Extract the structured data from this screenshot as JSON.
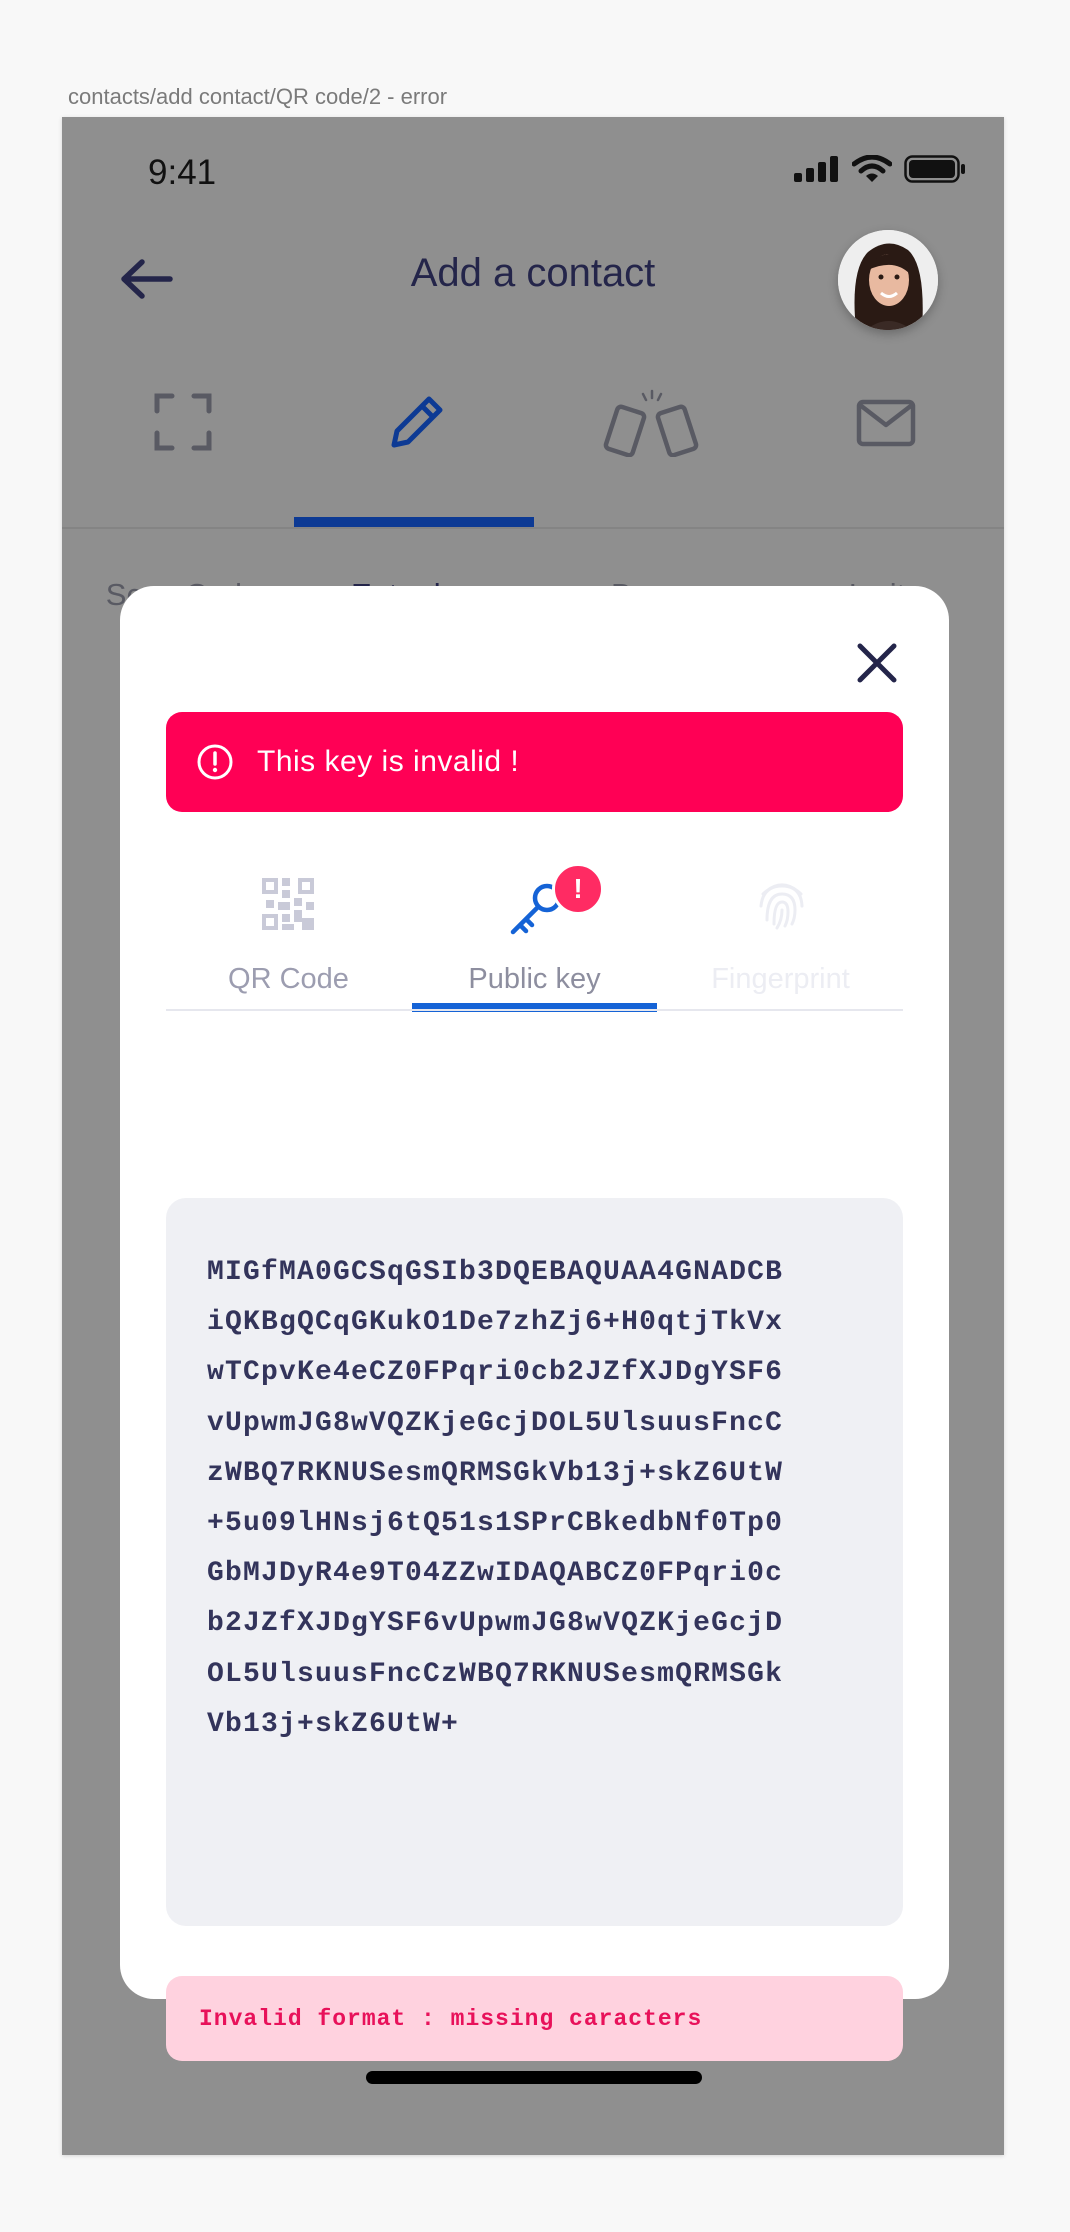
{
  "artboard": {
    "label": "contacts/add contact/QR code/2 - error"
  },
  "status_bar": {
    "time": "9:41",
    "icons": [
      "signal-icon",
      "wifi-icon",
      "battery-icon"
    ]
  },
  "header": {
    "title": "Add a contact",
    "back_icon": "arrow-left-icon"
  },
  "mode_tabs": [
    {
      "label": "Scan Code",
      "icon": "scan-frame-icon",
      "active": false
    },
    {
      "label": "Enter key",
      "icon": "pencil-icon",
      "active": true
    },
    {
      "label": "Bump",
      "icon": "bump-phones-icon",
      "active": false
    },
    {
      "label": "Invite",
      "icon": "envelope-icon",
      "active": false
    }
  ],
  "modal": {
    "error_banner": "This key is invalid !",
    "tabs": [
      {
        "label": "QR Code",
        "icon": "qr-code-icon",
        "state": "inactive"
      },
      {
        "label": "Public key",
        "icon": "key-icon",
        "state": "active",
        "badge": "!"
      },
      {
        "label": "Fingerprint",
        "icon": "fingerprint-icon",
        "state": "disabled"
      }
    ],
    "key_lines": [
      "MIGfMA0GCSqGSIb3DQEBAQUAA4GNADCB",
      "iQKBgQCqGKukO1De7zhZj6+H0qtjTkVx",
      "wTCpvKe4eCZ0FPqri0cb2JZfXJDgYSF6",
      "vUpwmJG8wVQZKjeGcjDOL5UlsuusFncC",
      "zWBQ7RKNUSesmQRMSGkVb1​3j+skZ6UtW",
      "+5u09lHNsj6tQ51s1SPrCBkedbNf0Tp0",
      "GbMJDyR4e9T04ZZwIDAQABCZ0FPqri0c",
      "b2JZfXJDgYSF6vUpwmJG8wVQZKjeGcjD",
      "OL5UlsuusFncCzWBQ7RKNUSesmQRMSGk",
      "Vb13j+skZ6UtW+"
    ],
    "format_error": "Invalid format : missing caracters"
  },
  "colors": {
    "primary": "#1563d6",
    "danger": "#ff0055",
    "danger_soft": "#ffd2df",
    "text_dark": "#24254a",
    "overlay": "#8f8f8f"
  }
}
